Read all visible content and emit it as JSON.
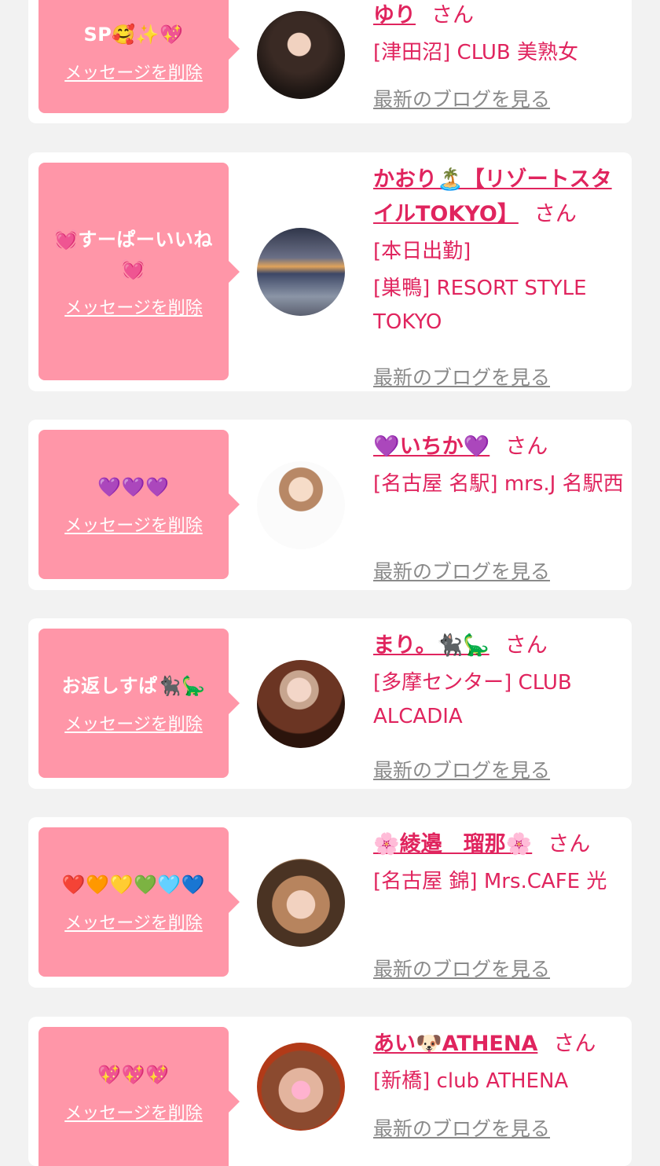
{
  "common": {
    "delete_label": "メッセージを削除",
    "san_label": "さん",
    "blog_label": "最新のブログを見る"
  },
  "items": [
    {
      "message": "SP🥰✨💖",
      "name": "ゆり",
      "shop_lines": [
        "[津田沼] CLUB 美熟女"
      ]
    },
    {
      "message": "💓すーぱーいいね💓",
      "name": "かおり🏝️【リゾートスタイルTOKYO】",
      "shop_lines": [
        "[本日出勤]",
        "[巣鴨] RESORT STYLE TOKYO"
      ]
    },
    {
      "message": "💜💜💜",
      "name": "💜いちか💜",
      "shop_lines": [
        "[名古屋 名駅] mrs.J 名駅西"
      ]
    },
    {
      "message": "お返しすぱ🐈‍⬛🦕",
      "name": "まり。🐈‍⬛🦕",
      "shop_lines": [
        "[多摩センター] CLUB ALCADIA"
      ]
    },
    {
      "message": "❤️🧡💛💚🩵💙",
      "name": "🌸綾邉　瑠那🌸",
      "shop_lines": [
        "[名古屋 錦] Mrs.CAFE 光"
      ]
    },
    {
      "message": "💖💖💖",
      "name": "あい🐶ATHENA",
      "shop_lines": [
        "[新橋] club ATHENA"
      ]
    }
  ]
}
